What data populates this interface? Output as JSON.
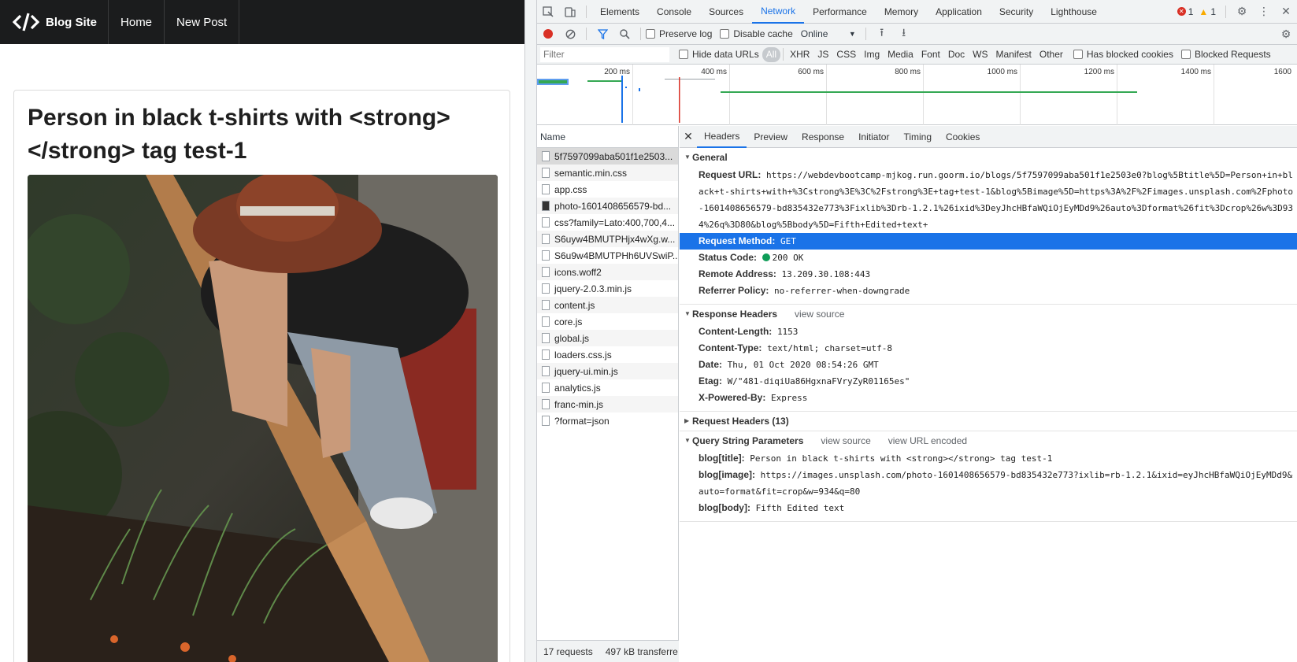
{
  "blog": {
    "brand": "Blog Site",
    "nav_home": "Home",
    "nav_new_post": "New Post",
    "post_title": "Person in black t-shirts with <strong></strong> tag test-1"
  },
  "devtools": {
    "tabs": [
      "Elements",
      "Console",
      "Sources",
      "Network",
      "Performance",
      "Memory",
      "Application",
      "Security",
      "Lighthouse"
    ],
    "active_tab": "Network",
    "error_count": "1",
    "warning_count": "1",
    "toolbar": {
      "preserve_log": "Preserve log",
      "disable_cache": "Disable cache",
      "throttle": "Online"
    },
    "filter": {
      "placeholder": "Filter",
      "hide_data_urls": "Hide data URLs",
      "types": [
        "All",
        "XHR",
        "JS",
        "CSS",
        "Img",
        "Media",
        "Font",
        "Doc",
        "WS",
        "Manifest",
        "Other"
      ],
      "has_blocked_cookies": "Has blocked cookies",
      "blocked_requests": "Blocked Requests"
    },
    "timeline_ticks": [
      "200 ms",
      "400 ms",
      "600 ms",
      "800 ms",
      "1000 ms",
      "1200 ms",
      "1400 ms",
      "1600"
    ],
    "list_header": "Name",
    "requests": [
      "5f7597099aba501f1e2503...",
      "semantic.min.css",
      "app.css",
      "photo-1601408656579-bd...",
      "css?family=Lato:400,700,4...",
      "S6uyw4BMUTPHjx4wXg.w...",
      "S6u9w4BMUTPHh6UVSwiP...",
      "icons.woff2",
      "jquery-2.0.3.min.js",
      "content.js",
      "core.js",
      "global.js",
      "loaders.css.js",
      "jquery-ui.min.js",
      "analytics.js",
      "franc-min.js",
      "?format=json"
    ],
    "footer_requests": "17 requests",
    "footer_transferred": "497 kB transferre",
    "detail_tabs": [
      "Headers",
      "Preview",
      "Response",
      "Initiator",
      "Timing",
      "Cookies"
    ],
    "general": {
      "title": "General",
      "request_url_key": "Request URL:",
      "request_url": "https://webdevbootcamp-mjkog.run.goorm.io/blogs/5f7597099aba501f1e2503e0?blog%5Btitle%5D=Person+in+black+t-shirts+with+%3Cstrong%3E%3C%2Fstrong%3E+tag+test-1&blog%5Bimage%5D=https%3A%2F%2Fimages.unsplash.com%2Fphoto-1601408656579-bd835432e773%3Fixlib%3Drb-1.2.1%26ixid%3DeyJhcHBfaWQiOjEyMDd9%26auto%3Dformat%26fit%3Dcrop%26w%3D934%26q%3D80&blog%5Bbody%5D=Fifth+Edited+text+",
      "method_key": "Request Method:",
      "method": "GET",
      "status_key": "Status Code:",
      "status": "200 OK",
      "remote_key": "Remote Address:",
      "remote": "13.209.30.108:443",
      "referrer_key": "Referrer Policy:",
      "referrer": "no-referrer-when-downgrade"
    },
    "response_headers": {
      "title": "Response Headers",
      "view_source": "view source",
      "rows": [
        {
          "k": "Content-Length:",
          "v": "1153"
        },
        {
          "k": "Content-Type:",
          "v": "text/html; charset=utf-8"
        },
        {
          "k": "Date:",
          "v": "Thu, 01 Oct 2020 08:54:26 GMT"
        },
        {
          "k": "Etag:",
          "v": "W/\"481-diqiUa86HgxnaFVryZyR01165es\""
        },
        {
          "k": "X-Powered-By:",
          "v": "Express"
        }
      ]
    },
    "request_headers": {
      "title": "Request Headers (13)"
    },
    "query": {
      "title": "Query String Parameters",
      "view_source": "view source",
      "view_url_encoded": "view URL encoded",
      "rows": [
        {
          "k": "blog[title]:",
          "v": "Person in black t-shirts with <strong></strong> tag test-1"
        },
        {
          "k": "blog[image]:",
          "v": "https://images.unsplash.com/photo-1601408656579-bd835432e773?ixlib=rb-1.2.1&ixid=eyJhcHBfaWQiOjEyMDd9&auto=format&fit=crop&w=934&q=80"
        },
        {
          "k": "blog[body]:",
          "v": "Fifth Edited text"
        }
      ]
    }
  }
}
